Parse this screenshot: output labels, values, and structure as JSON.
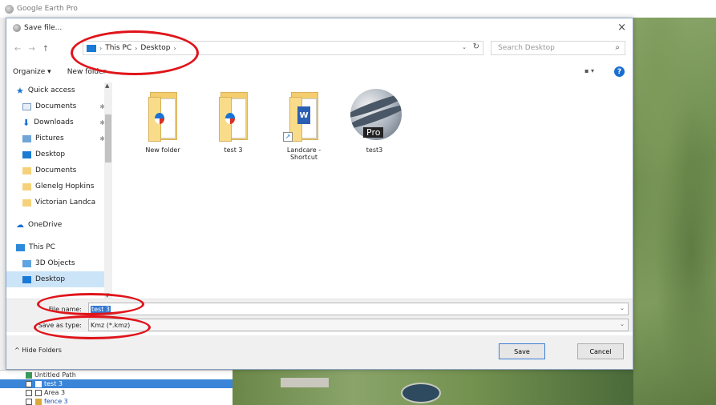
{
  "app": {
    "title": "Google Earth Pro"
  },
  "dialog": {
    "title": "Save file...",
    "close_label": "×",
    "nav": {
      "back": "←",
      "forward": "→",
      "up": "↑"
    },
    "address": {
      "crumbs": [
        "This PC",
        "Desktop"
      ],
      "separator": "›",
      "dropdown": "⌄",
      "refresh": "↻"
    },
    "search": {
      "placeholder": "Search Desktop",
      "icon": "⌕"
    },
    "toolbar": {
      "organize": "Organize ▾",
      "new_folder": "New folder",
      "view": "▪ ▾",
      "help": "?"
    },
    "nav_pane": [
      {
        "label": "Quick access",
        "icon": "star-icon",
        "pinned": false
      },
      {
        "label": "Documents",
        "icon": "documents-icon",
        "pinned": true
      },
      {
        "label": "Downloads",
        "icon": "downloads-icon",
        "pinned": true
      },
      {
        "label": "Pictures",
        "icon": "pictures-icon",
        "pinned": true
      },
      {
        "label": "Desktop",
        "icon": "desktop-icon",
        "pinned": false
      },
      {
        "label": "Documents",
        "icon": "folder-icon",
        "pinned": false
      },
      {
        "label": "Glenelg Hopkins",
        "icon": "folder-icon",
        "pinned": false
      },
      {
        "label": "Victorian Landca",
        "icon": "folder-icon",
        "pinned": false
      },
      {
        "label": "OneDrive",
        "icon": "onedrive-icon",
        "pinned": false
      },
      {
        "label": "This PC",
        "icon": "this-pc-icon",
        "pinned": false
      },
      {
        "label": "3D Objects",
        "icon": "3d-objects-icon",
        "pinned": false
      },
      {
        "label": "Desktop",
        "icon": "desktop-icon",
        "pinned": false,
        "selected": true
      }
    ],
    "pin_glyph": "✱",
    "files": [
      {
        "name": "New folder",
        "type": "folder"
      },
      {
        "name": "test 3",
        "type": "folder"
      },
      {
        "name": "Landcare - Shortcut",
        "type": "shortcut"
      },
      {
        "name": "test3",
        "type": "app"
      }
    ],
    "pro_label": "Pro",
    "word_letter": "W",
    "file_name": {
      "label": "File name:",
      "value": "test 3"
    },
    "save_type": {
      "label": "Save as type:",
      "value": "Kmz (*.kmz)"
    },
    "hide_folders": "^  Hide Folders",
    "save_button": "Save",
    "cancel_button": "Cancel"
  },
  "layers_panel": {
    "items": [
      {
        "label": "Untitled Path",
        "selected": false
      },
      {
        "label": "test 3",
        "selected": true
      },
      {
        "label": "Area 3",
        "selected": false
      },
      {
        "label": "fence 3",
        "selected": false
      }
    ]
  },
  "colors": {
    "annotation": "#e0141a",
    "accent": "#1a73d4"
  }
}
